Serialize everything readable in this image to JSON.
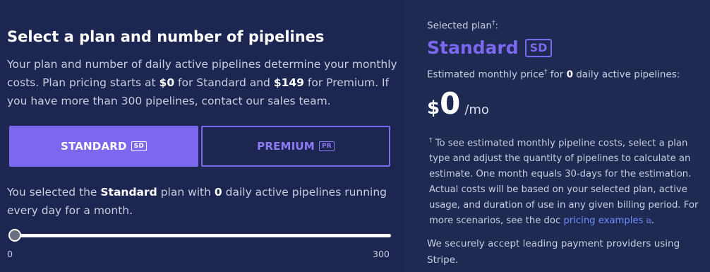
{
  "heading": "Select a plan and number of pipelines",
  "intro": {
    "part1": "Your plan and number of daily active pipelines determine your monthly costs. Plan pricing starts at ",
    "price_standard": "$0",
    "part2": " for Standard and ",
    "price_premium": "$149",
    "part3": " for Premium. If you have more than 300 pipelines, contact our sales team."
  },
  "plans": {
    "standard": {
      "label": "STANDARD",
      "badge": "SD",
      "selected": true
    },
    "premium": {
      "label": "PREMIUM",
      "badge": "PR",
      "selected": false
    }
  },
  "selection": {
    "part1": "You selected the ",
    "plan": "Standard",
    "part2": " plan with ",
    "count": "0",
    "part3": " daily active pipelines running every day for a month."
  },
  "slider": {
    "value": 0,
    "min_label": "0",
    "max_label": "300",
    "min": 0,
    "max": 300
  },
  "summary": {
    "selected_label": "Selected plan",
    "dagger": "†",
    "colon": ":",
    "plan_name": "Standard",
    "plan_badge": "SD",
    "estimate_part1": "Estimated monthly price",
    "estimate_part2": " for ",
    "estimate_count": "0",
    "estimate_part3": " daily active pipelines:",
    "currency": "$",
    "amount": "0",
    "period": "/mo"
  },
  "note": {
    "dagger": "†",
    "text": " To see estimated monthly pipeline costs, select a plan type and adjust the quantity of pipelines to calculate an estimate. One month equals 30-days for the estimation. Actual costs will be based on your selected plan, active usage, and duration of use in any given billing period. For more scenarios, see the doc ",
    "link": "pricing examples",
    "period": "."
  },
  "payment_text": "We securely accept leading payment providers using Stripe.",
  "colors": {
    "background": "#1c2650",
    "panel": "#1e2a52",
    "accent": "#7b68ee",
    "link": "#6f8cff"
  },
  "icons": {
    "external_link": "external-link-icon"
  }
}
